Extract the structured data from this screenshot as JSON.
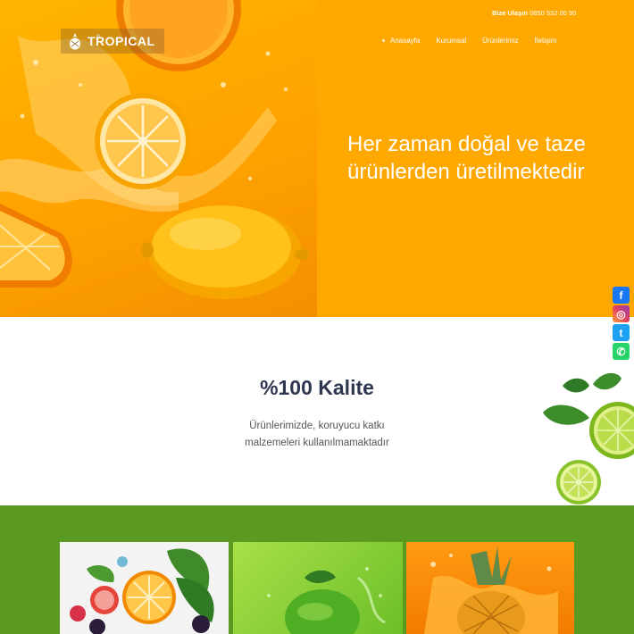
{
  "header": {
    "brand": "TROPICAL",
    "contact_label": "Bize Ulaşın",
    "contact_phone": "0850 532 00 90",
    "nav": [
      {
        "label": "Anasayfa"
      },
      {
        "label": "Kurumsal"
      },
      {
        "label": "Ürünlerimiz"
      },
      {
        "label": "İletişim"
      }
    ]
  },
  "hero": {
    "heading": "Her zaman doğal ve taze ürünlerden üretilmektedir"
  },
  "social": {
    "facebook_glyph": "f",
    "instagram_glyph": "◎",
    "twitter_glyph": "t",
    "whatsapp_glyph": "✆"
  },
  "quality": {
    "title": "%100 Kalite",
    "text": "Ürünlerimizde, koruyucu katkı malzemeleri kullanılmamaktadır"
  },
  "colors": {
    "hero_orange": "#ffa800",
    "products_green": "#5a9a20",
    "title_navy": "#2e3650"
  }
}
